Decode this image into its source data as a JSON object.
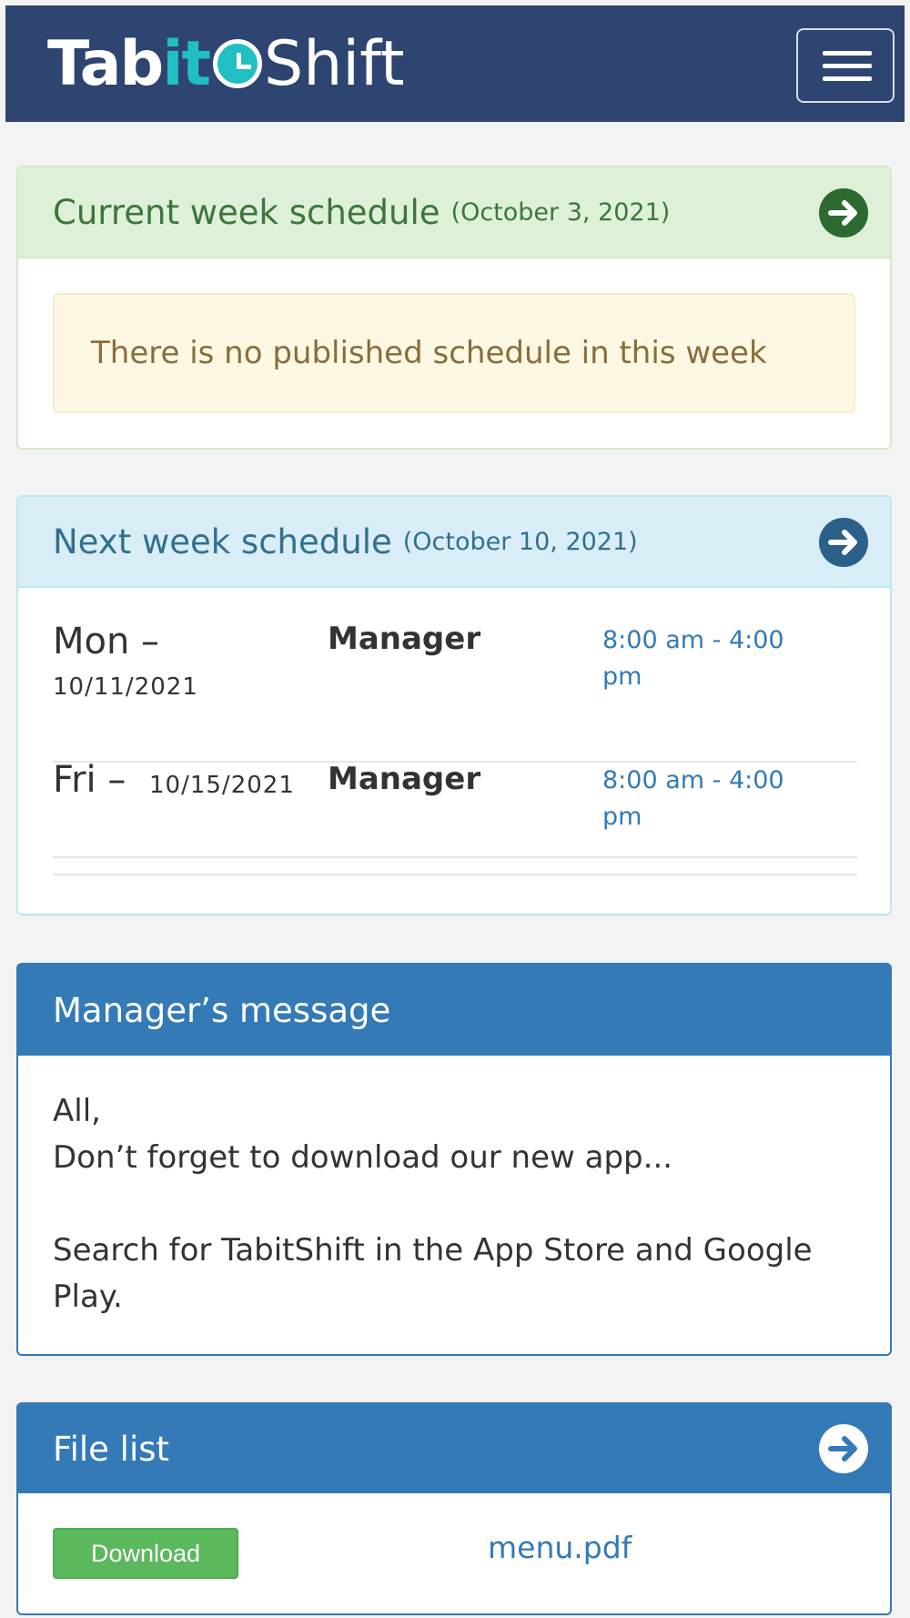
{
  "header": {
    "logo_text": {
      "part1": "Ta",
      "part2": "b",
      "part3": "it",
      "part4": "Shift"
    },
    "menu_icon": "hamburger-icon"
  },
  "current_week": {
    "title": "Current week schedule",
    "date": "(October 3, 2021)",
    "alert": "There is no published schedule in this week",
    "arrow_icon": "arrow-right-circle-icon"
  },
  "next_week": {
    "title": "Next week schedule",
    "date": "(October 10, 2021)",
    "arrow_icon": "arrow-right-circle-icon",
    "shifts": [
      {
        "day": "Mon –",
        "date": "10/11/2021",
        "role": "Manager",
        "time": "8:00 am - 4:00 pm"
      },
      {
        "day": "Fri –",
        "date": "10/15/2021",
        "role": "Manager",
        "time": "8:00 am - 4:00 pm"
      }
    ]
  },
  "manager_message": {
    "title": "Manager’s message",
    "line1": "All,",
    "line2": "Don’t forget to download our new app...",
    "line3": "Search for TabitShift in the App Store and Google Play."
  },
  "file_list": {
    "title": "File list",
    "arrow_icon": "arrow-right-circle-icon",
    "files": [
      {
        "button": "Download",
        "name": "menu.pdf"
      }
    ]
  },
  "colors": {
    "navbar": "#2e4471",
    "brand_teal": "#21bfc4",
    "success_bg": "#dff0d8",
    "info_bg": "#d9edf7",
    "primary": "#337ab7",
    "warning_bg": "#fcf8e3",
    "download_btn": "#5cb85c"
  }
}
